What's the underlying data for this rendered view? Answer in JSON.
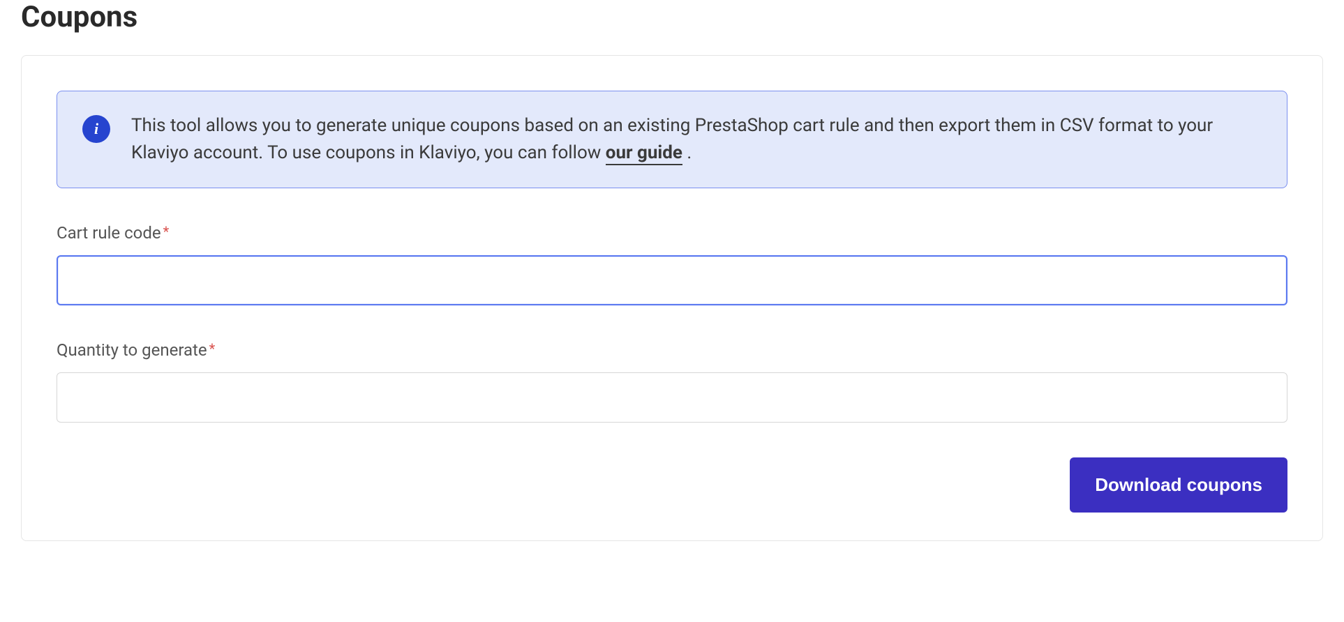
{
  "header": {
    "title": "Coupons"
  },
  "alert": {
    "text_before_link": "This tool allows you to generate unique coupons based on an existing PrestaShop cart rule and then export them in CSV format to your Klaviyo account. To use coupons in Klaviyo, you can follow ",
    "link_text": "our guide",
    "text_after_link": " ."
  },
  "form": {
    "cart_rule_label": "Cart rule code",
    "cart_rule_value": "",
    "quantity_label": "Quantity to generate",
    "quantity_value": "",
    "required_marker": "*",
    "download_button_label": "Download coupons"
  }
}
